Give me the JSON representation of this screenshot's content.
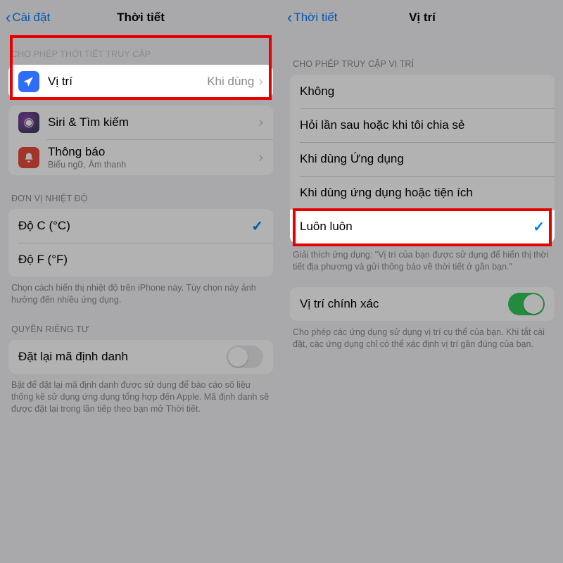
{
  "left": {
    "nav": {
      "back": "Cài đặt",
      "title": "Thời tiết"
    },
    "section_access": "CHO PHÉP THỜI TIẾT TRUY CẬP",
    "rows": {
      "location": {
        "label": "Vị trí",
        "detail": "Khi dùng"
      },
      "siri": {
        "label": "Siri & Tìm kiếm"
      },
      "notifications": {
        "label": "Thông báo",
        "sub": "Biểu ngữ, Âm thanh"
      }
    },
    "section_temp": "ĐƠN VỊ NHIỆT ĐỘ",
    "temp": {
      "c": "Độ C (°C)",
      "f": "Độ F (°F)"
    },
    "temp_footer": "Chọn cách hiển thị nhiệt độ trên iPhone này. Tùy chọn này ảnh hưởng đến nhiều ứng dụng.",
    "section_privacy": "QUYỀN RIÊNG TƯ",
    "reset_id": "Đặt lại mã định danh",
    "reset_footer": "Bật để đặt lại mã định danh được sử dụng để báo cáo số liệu thống kê sử dụng ứng dụng tổng hợp đến Apple. Mã định danh sẽ được đặt lại trong lần tiếp theo bạn mở Thời tiết."
  },
  "right": {
    "nav": {
      "back": "Thời tiết",
      "title": "Vị trí"
    },
    "section": "CHO PHÉP TRUY CẬP VỊ TRÍ",
    "options": {
      "none": "Không",
      "ask": "Hỏi lần sau hoặc khi tôi chia sẻ",
      "while": "Khi dùng Ứng dụng",
      "while_widgets": "Khi dùng ứng dụng hoặc tiện ích",
      "always": "Luôn luôn"
    },
    "explain": "Giải thích ứng dụng: \"Vị trí của bạn được sử dụng để hiển thị thời tiết địa phương và gửi thông báo về thời tiết ở gần bạn.\"",
    "precise": "Vị trí chính xác",
    "precise_footer": "Cho phép các ứng dụng sử dụng vị trí cụ thể của bạn. Khi tắt cài đặt, các ứng dụng chỉ có thể xác định vị trí gần đúng của bạn."
  }
}
